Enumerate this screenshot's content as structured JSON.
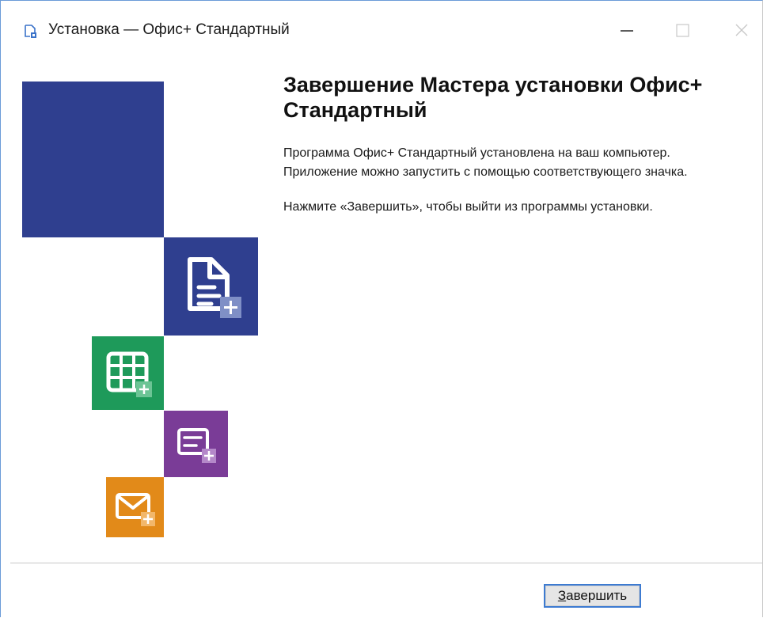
{
  "window": {
    "title": "Установка — Офис+ Стандартный",
    "icon": "installer-app-icon",
    "controls": {
      "minimize_icon": "minimize-icon",
      "maximize_icon": "maximize-icon",
      "close_icon": "close-icon"
    }
  },
  "branding": {
    "tiles": [
      {
        "name": "doc-add-icon",
        "color": "#2f3f8f"
      },
      {
        "name": "spreadsheet-add-icon",
        "color": "#1e9a5a"
      },
      {
        "name": "presentation-add-icon",
        "color": "#7a3c97"
      },
      {
        "name": "mail-add-icon",
        "color": "#e28a19"
      }
    ],
    "accent": "#2f3f8f"
  },
  "content": {
    "heading": "Завершение Мастера установки Офис+ Стандартный",
    "line1": "Программа Офис+ Стандартный установлена на ваш компьютер.",
    "line2": "Приложение можно запустить с помощью соответствующего значка.",
    "line3": "Нажмите «Завершить», чтобы выйти из программы установки."
  },
  "footer": {
    "finish_accel": "З",
    "finish_rest": "авершить"
  }
}
